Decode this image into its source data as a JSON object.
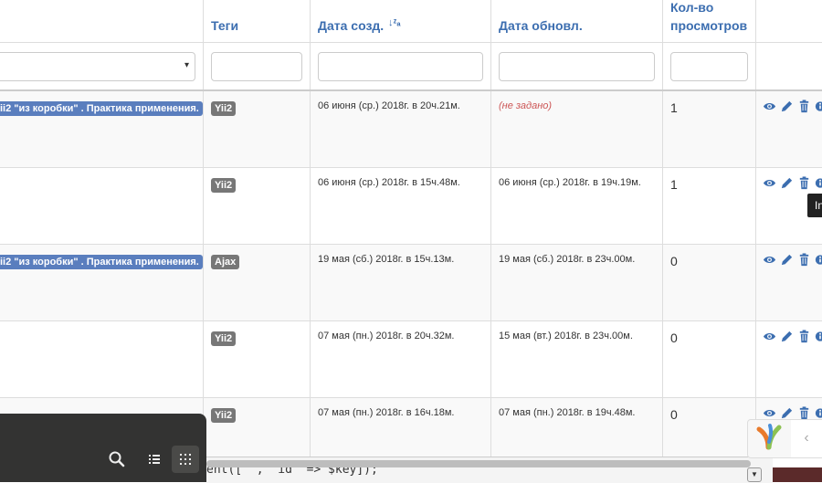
{
  "columns": {
    "tags": "Теги",
    "created": "Дата созд.",
    "created_sort": "↓ᶻₐ",
    "updated": "Дата обновл.",
    "views_line1": "Кол-во",
    "views_line2": "просмотров"
  },
  "filters": {
    "category_select_arrow": "▾",
    "tags": "",
    "created": "",
    "updated": "",
    "views": ""
  },
  "rows": [
    {
      "category": "ii2 \"из коробки\" . Практика применения.",
      "tag": "Yii2",
      "created": "06 июня (ср.) 2018г. в 20ч.21м.",
      "updated": "(не задано)",
      "views": "1"
    },
    {
      "category": "",
      "tag": "Yii2",
      "created": "06 июня (ср.) 2018г. в 15ч.48м.",
      "updated": "06 июня (ср.) 2018г. в 19ч.19м.",
      "views": "1"
    },
    {
      "category": "ii2 \"из коробки\" . Практика применения.",
      "tag": "Ajax",
      "created": "19 мая (сб.) 2018г. в 15ч.13м.",
      "updated": "19 мая (сб.) 2018г. в 23ч.00м.",
      "views": "0"
    },
    {
      "category": "",
      "tag": "Yii2",
      "created": "07 мая (пн.) 2018г. в 20ч.32м.",
      "updated": "15 мая (вт.) 2018г. в 23ч.00м.",
      "views": "0"
    },
    {
      "category": "",
      "tag": "Yii2",
      "created": "07 мая (пн.) 2018г. в 16ч.18м.",
      "updated": "07 мая (пн.) 2018г. в 19ч.48м.",
      "views": "0"
    }
  ],
  "tooltip_text": "In",
  "editor_text": "ent([ ', 'id' => $key]);",
  "colors": {
    "header": "#3c6eb0",
    "badge_blue": "#5a7ebe",
    "badge_gray": "#777777",
    "notset": "#cc5555"
  },
  "icons": [
    "eye-icon",
    "pencil-icon",
    "trash-icon",
    "info-icon"
  ],
  "dock": {
    "search_icon": "search-icon",
    "list_icon": "list-icon",
    "grid_icon": "grid-icon"
  }
}
